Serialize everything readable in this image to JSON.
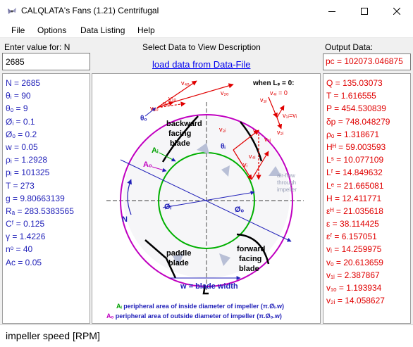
{
  "window": {
    "title": "CALQLATA's  Fans (1.21)  Centrifugal",
    "icon": "fan-logo-icon",
    "controls": [
      "minimize-icon",
      "maximize-icon",
      "close-icon"
    ]
  },
  "menu": [
    "File",
    "Options",
    "Data Listing",
    "Help"
  ],
  "input": {
    "label": "Enter value for: N",
    "value": "2685"
  },
  "center": {
    "heading": "Select Data to View Description",
    "load_link": "load data from Data-File"
  },
  "output": {
    "label": "Output Data:",
    "value": "pc = 102073.046875"
  },
  "inputs_list": [
    "N = 2685",
    "θᵢ = 90",
    "θₒ = 9",
    "Øᵢ = 0.1",
    "Øₒ = 0.2",
    "w = 0.05",
    "ρᵢ = 1.2928",
    "pᵢ = 101325",
    "T = 273",
    "g = 9.80663139",
    "Rₐ = 283.5383565",
    "Cᶠ = 0.125",
    "γ = 1.4226",
    "nᵒ = 40",
    "Ac = 0.05"
  ],
  "outputs_list": [
    "Q = 135.03073",
    "T = 1.616555",
    "P = 454.530839",
    "δp = 748.048279",
    "ρₒ = 1.318671",
    "Hᴴ = 59.003593",
    "Lˢ = 10.077109",
    "Lᶠ = 14.849632",
    "Lᵉ = 21.665081",
    "H = 12.411771",
    "εᴴ = 21.035618",
    "ε = 38.114425",
    "εᶠ = 6.157051",
    "vᵢ = 14.259975",
    "vₒ = 20.613659",
    "v₁ᵢ = 2.387867",
    "v₁ₒ = 1.193934",
    "v₂ᵢ = 14.058627"
  ],
  "diagram": {
    "labels": {
      "backward": "backward",
      "facing": "facing",
      "blade": "blade",
      "paddle": "paddle",
      "paddle_blade": "blade",
      "forward": "forward",
      "forward_facing": "facing",
      "forward_blade": "blade",
      "blade_width": "w = blade width",
      "airflow_1": "air-flow",
      "airflow_2": "through",
      "airflow_3": "impeller",
      "when_ls": "when Lₛ = 0:",
      "ai": "Aᵢ",
      "ao": "Aₒ",
      "phi_i": "Øᵢ",
      "phi_o": "Øₒ",
      "n": "N",
      "theta_o": "θₒ",
      "theta_i": "θᵢ",
      "v4o": "v₄ₒ",
      "v2o": "v₂ₒ",
      "v1o": "v₁ₒ",
      "v3o": "v₃ₒ",
      "vo": "vₒ",
      "v4i": "v₄ᵢ = 0",
      "v3i_top": "v₃ᵢ",
      "v1i_vi": "v₁ᵢ=vᵢ",
      "v2i_top": "v₂ᵢ",
      "v3i": "v₃ᵢ",
      "v4i_mid": "v₄ᵢ",
      "vi": "vᵢ",
      "v1i": "v₁ᵢ",
      "v2i": "v₂ᵢ",
      "legend_ai_sym": "Aᵢ",
      "legend_ai": " peripheral area of inside diameter of impeller (π.Øᵢ.w)",
      "legend_ao_sym": "Aₒ",
      "legend_ao": " peripheral area of outside diameter of impeller (π.Øₒ.w)"
    },
    "colors": {
      "outer_circle": "#c000c0",
      "inner_circle": "#00b000",
      "vectors": "#e00000",
      "labels_blue": "#1f1fb8",
      "blades": "#000000"
    }
  },
  "status": "impeller speed [RPM]"
}
